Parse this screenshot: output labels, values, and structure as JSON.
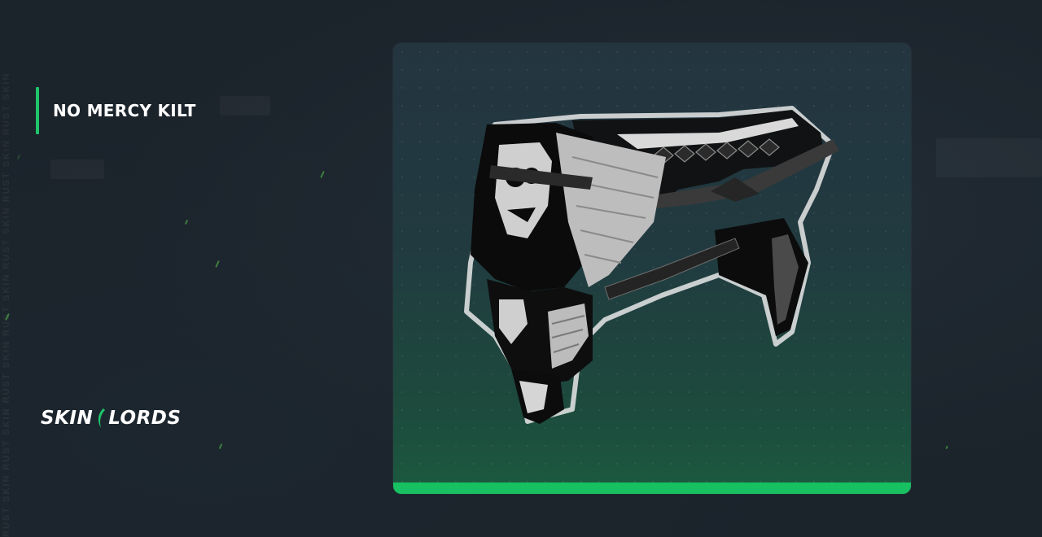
{
  "item": {
    "name": "NO MERCY KILT"
  },
  "brand": {
    "logo_left": "SKIN",
    "logo_right": "LORDS",
    "watermark": "RUST SKIN RUST SKIN RUST SKIN RUST SKIN RUST SKIN RUST SKIN RUST SKIN"
  },
  "colors": {
    "background": "#1b232b",
    "accent": "#1fc46a",
    "card_bottom_bar": "#17c060"
  },
  "icons": {
    "logo_mark": "green-blade-icon",
    "item_image": "kilt-skin-icon"
  }
}
